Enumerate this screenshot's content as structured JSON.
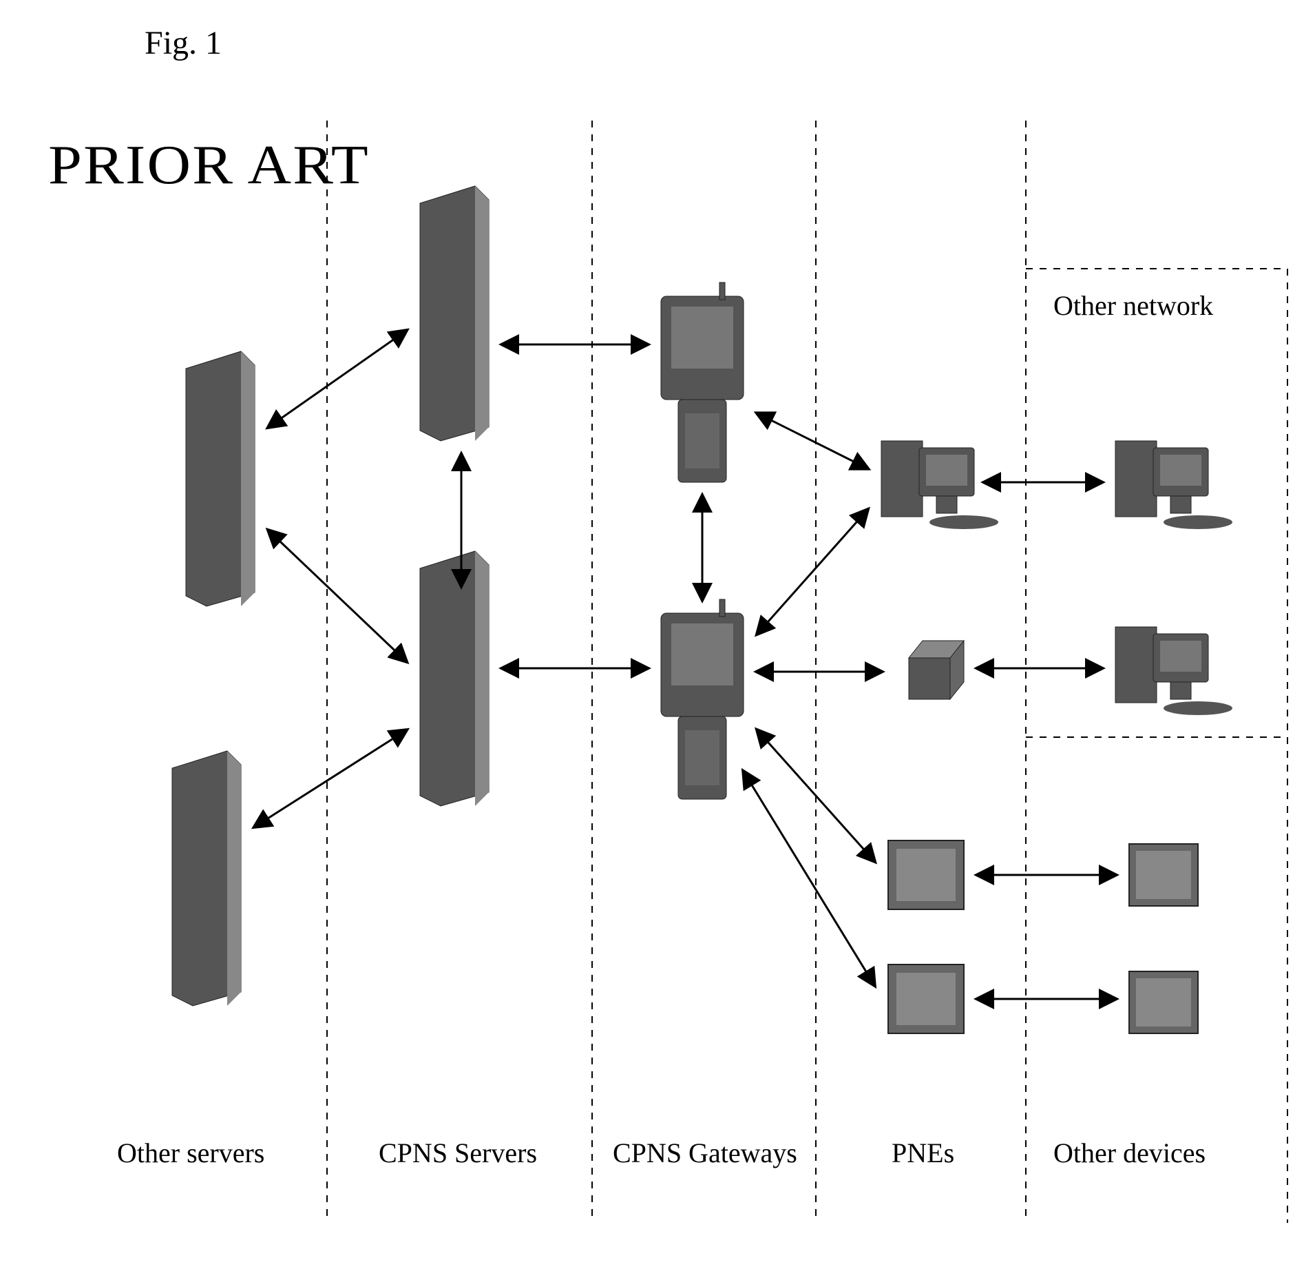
{
  "figure_label": "Fig. 1",
  "prior_art": "PRIOR ART",
  "columns": {
    "other_servers": "Other servers",
    "cpns_servers": "CPNS Servers",
    "cpns_gateways": "CPNS Gateways",
    "pnes": "PNEs",
    "other_devices": "Other devices"
  },
  "regions": {
    "other_network": "Other network"
  }
}
